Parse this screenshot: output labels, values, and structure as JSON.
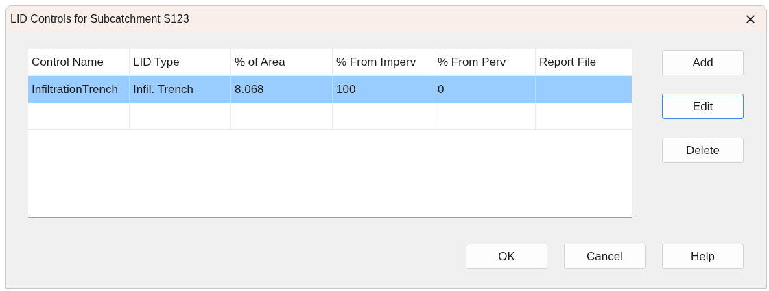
{
  "window": {
    "title": "LID Controls for Subcatchment S123",
    "close": "×"
  },
  "table": {
    "columns": [
      "Control Name",
      "LID Type",
      "% of Area",
      "% From Imperv",
      "% From Perv",
      "Report File"
    ],
    "rows": [
      {
        "cells": [
          "InfiltrationTrench",
          "Infil. Trench",
          "8.068",
          "100",
          "0"
        ],
        "selected": true
      }
    ]
  },
  "side_buttons": [
    {
      "label": "Add",
      "focused": false
    },
    {
      "label": "Edit",
      "focused": true
    },
    {
      "label": "Delete",
      "focused": false
    }
  ],
  "bottom_buttons": [
    {
      "label": "OK",
      "focused": false
    },
    {
      "label": "Cancel",
      "focused": false
    },
    {
      "label": "Help",
      "focused": false
    }
  ]
}
